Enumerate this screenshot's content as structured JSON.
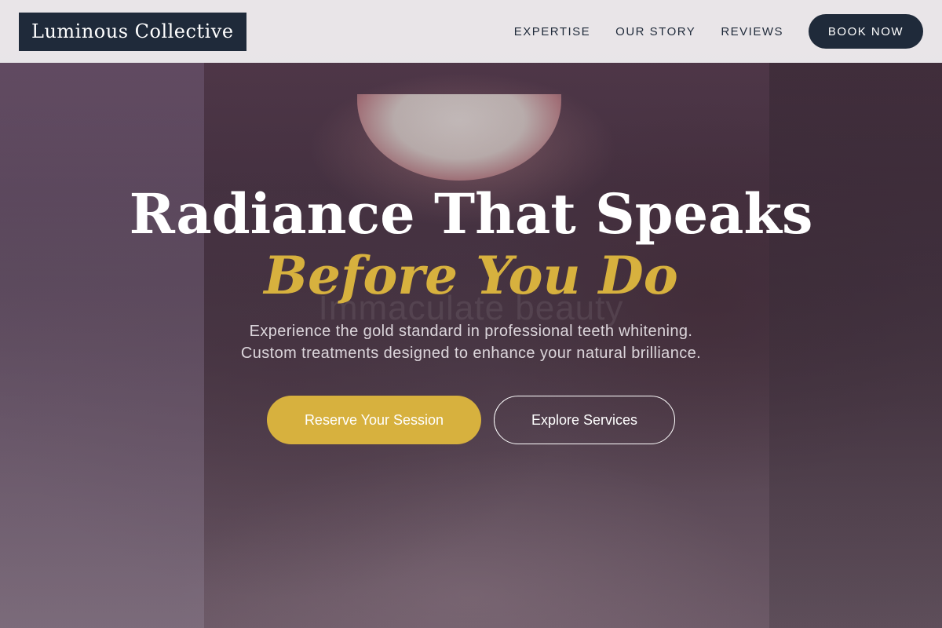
{
  "header": {
    "logo": "Luminous Collective",
    "nav": [
      {
        "label": "EXPERTISE"
      },
      {
        "label": "OUR STORY"
      },
      {
        "label": "REVIEWS"
      }
    ],
    "cta": "BOOK NOW"
  },
  "hero": {
    "headline_1": "Radiance That Speaks",
    "headline_2": "Before You Do",
    "watermark": "Immaculate beauty",
    "subtext_1": "Experience the gold standard in professional teeth whitening.",
    "subtext_2": "Custom treatments designed to enhance your natural brilliance.",
    "primary_cta": "Reserve Your Session",
    "secondary_cta": "Explore Services"
  },
  "colors": {
    "navy": "#1f2a3a",
    "gold": "#d7b13e",
    "white": "#ffffff"
  }
}
